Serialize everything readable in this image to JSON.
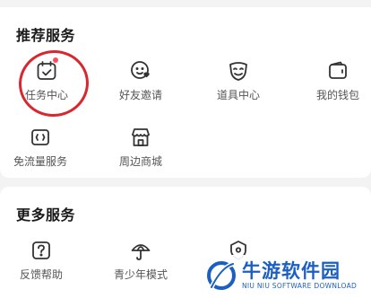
{
  "recommended": {
    "title": "推荐服务",
    "items": [
      {
        "label": "任务中心",
        "icon": "task-calendar-icon",
        "badge": true
      },
      {
        "label": "好友邀请",
        "icon": "friend-invite-icon"
      },
      {
        "label": "道具中心",
        "icon": "mask-icon"
      },
      {
        "label": "我的钱包",
        "icon": "wallet-icon"
      },
      {
        "label": "免流量服务",
        "icon": "data-free-icon"
      },
      {
        "label": "周边商城",
        "icon": "shop-icon"
      }
    ]
  },
  "more": {
    "title": "更多服务",
    "items": [
      {
        "label": "反馈帮助",
        "icon": "feedback-icon"
      },
      {
        "label": "青少年模式",
        "icon": "umbrella-icon"
      },
      {
        "label": "",
        "icon": "shield-icon"
      }
    ]
  },
  "watermark": {
    "title": "牛游软件园",
    "subtitle": "NIU NIU SOFTWARE DOWNLOAD"
  },
  "colors": {
    "annotation": "#d8272f",
    "badge": "#ff4d5a",
    "watermark": "#1c5fc4"
  }
}
